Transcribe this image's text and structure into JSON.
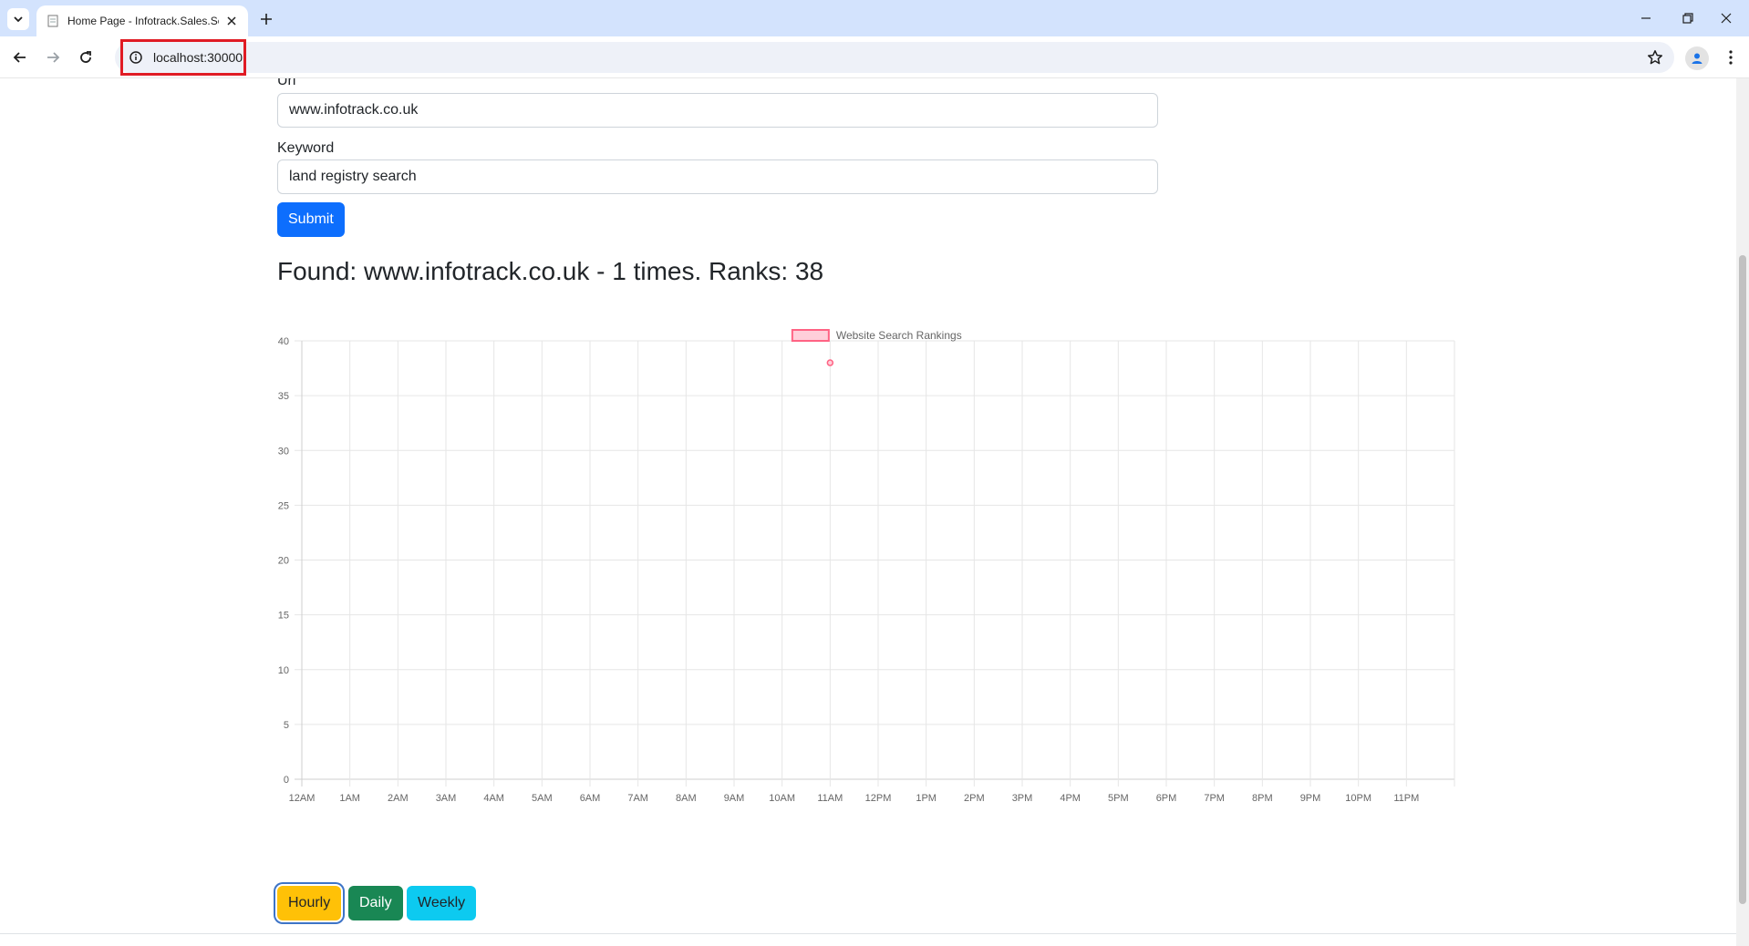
{
  "browser": {
    "tab_title": "Home Page - Infotrack.Sales.Se",
    "url": "localhost:30000"
  },
  "form": {
    "url_label": "Url",
    "url_value": "www.infotrack.co.uk",
    "keyword_label": "Keyword",
    "keyword_value": "land registry search",
    "submit_label": "Submit"
  },
  "result": {
    "heading": "Found: www.infotrack.co.uk - 1 times. Ranks: 38"
  },
  "chart_data": {
    "type": "scatter",
    "categories": [
      "12AM",
      "1AM",
      "2AM",
      "3AM",
      "4AM",
      "5AM",
      "6AM",
      "7AM",
      "8AM",
      "9AM",
      "10AM",
      "11AM",
      "12PM",
      "1PM",
      "2PM",
      "3PM",
      "4PM",
      "5PM",
      "6PM",
      "7PM",
      "8PM",
      "9PM",
      "10PM",
      "11PM"
    ],
    "series": [
      {
        "name": "Website Search Rankings",
        "points": [
          {
            "x": "11AM",
            "y": 38
          }
        ]
      }
    ],
    "ylim": [
      0,
      40
    ],
    "yticks": [
      0,
      5,
      10,
      15,
      20,
      25,
      30,
      35,
      40
    ],
    "legend": "top-center",
    "grid": true,
    "series_color": "#ff6384",
    "series_fill": "#ffcfda"
  },
  "range_buttons": {
    "hourly": "Hourly",
    "daily": "Daily",
    "weekly": "Weekly"
  },
  "colors": {
    "primary": "#0d6efd",
    "warning": "#ffc107",
    "success": "#198754",
    "info": "#0dcaf0"
  }
}
